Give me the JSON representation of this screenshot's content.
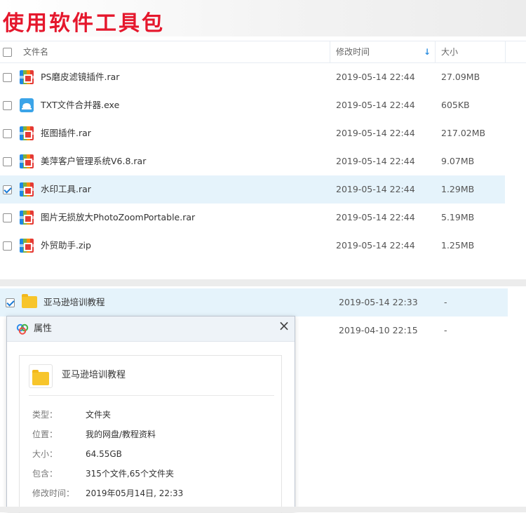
{
  "banner": {
    "title": "使用软件工具包"
  },
  "table_header": {
    "name": "文件名",
    "modified": "修改时间",
    "size": "大小",
    "sort_arrow": "↓"
  },
  "files": [
    {
      "name": "PS磨皮滤镜插件.rar",
      "date": "2019-05-14 22:44",
      "size": "27.09MB",
      "icon": "rar-icon",
      "checked": false
    },
    {
      "name": "TXT文件合并器.exe",
      "date": "2019-05-14 22:44",
      "size": "605KB",
      "icon": "exe-icon",
      "checked": false
    },
    {
      "name": "抠图插件.rar",
      "date": "2019-05-14 22:44",
      "size": "217.02MB",
      "icon": "rar-icon",
      "checked": false
    },
    {
      "name": "美萍客户管理系统V6.8.rar",
      "date": "2019-05-14 22:44",
      "size": "9.07MB",
      "icon": "rar-icon",
      "checked": false
    },
    {
      "name": "水印工具.rar",
      "date": "2019-05-14 22:44",
      "size": "1.29MB",
      "icon": "rar-icon",
      "checked": true
    },
    {
      "name": "图片无损放大PhotoZoomPortable.rar",
      "date": "2019-05-14 22:44",
      "size": "5.19MB",
      "icon": "rar-icon",
      "checked": false
    },
    {
      "name": "外贸助手.zip",
      "date": "2019-05-14 22:44",
      "size": "1.25MB",
      "icon": "rar-icon",
      "checked": false
    }
  ],
  "folders": [
    {
      "name": "亚马逊培训教程",
      "date": "2019-05-14 22:33",
      "size": "-",
      "checked": true
    },
    {
      "name": "",
      "date": "2019-04-10 22:15",
      "size": "-",
      "checked": false
    }
  ],
  "dialog": {
    "title": "属性",
    "close": "×",
    "name": "亚马逊培训教程",
    "props": [
      {
        "label": "类型：",
        "value": "文件夹"
      },
      {
        "label": "位置：",
        "value": "我的网盘/教程资料"
      },
      {
        "label": "大小：",
        "value": "64.55GB"
      },
      {
        "label": "包含：",
        "value": "315个文件,65个文件夹"
      },
      {
        "label": "修改时间：",
        "value": "2019年05月14日, 22:33"
      }
    ]
  },
  "colors": {
    "accent": "#e5172c",
    "selected_row": "#e5f3fb",
    "link_blue": "#2f8fe0",
    "folder": "#f7c52b"
  }
}
